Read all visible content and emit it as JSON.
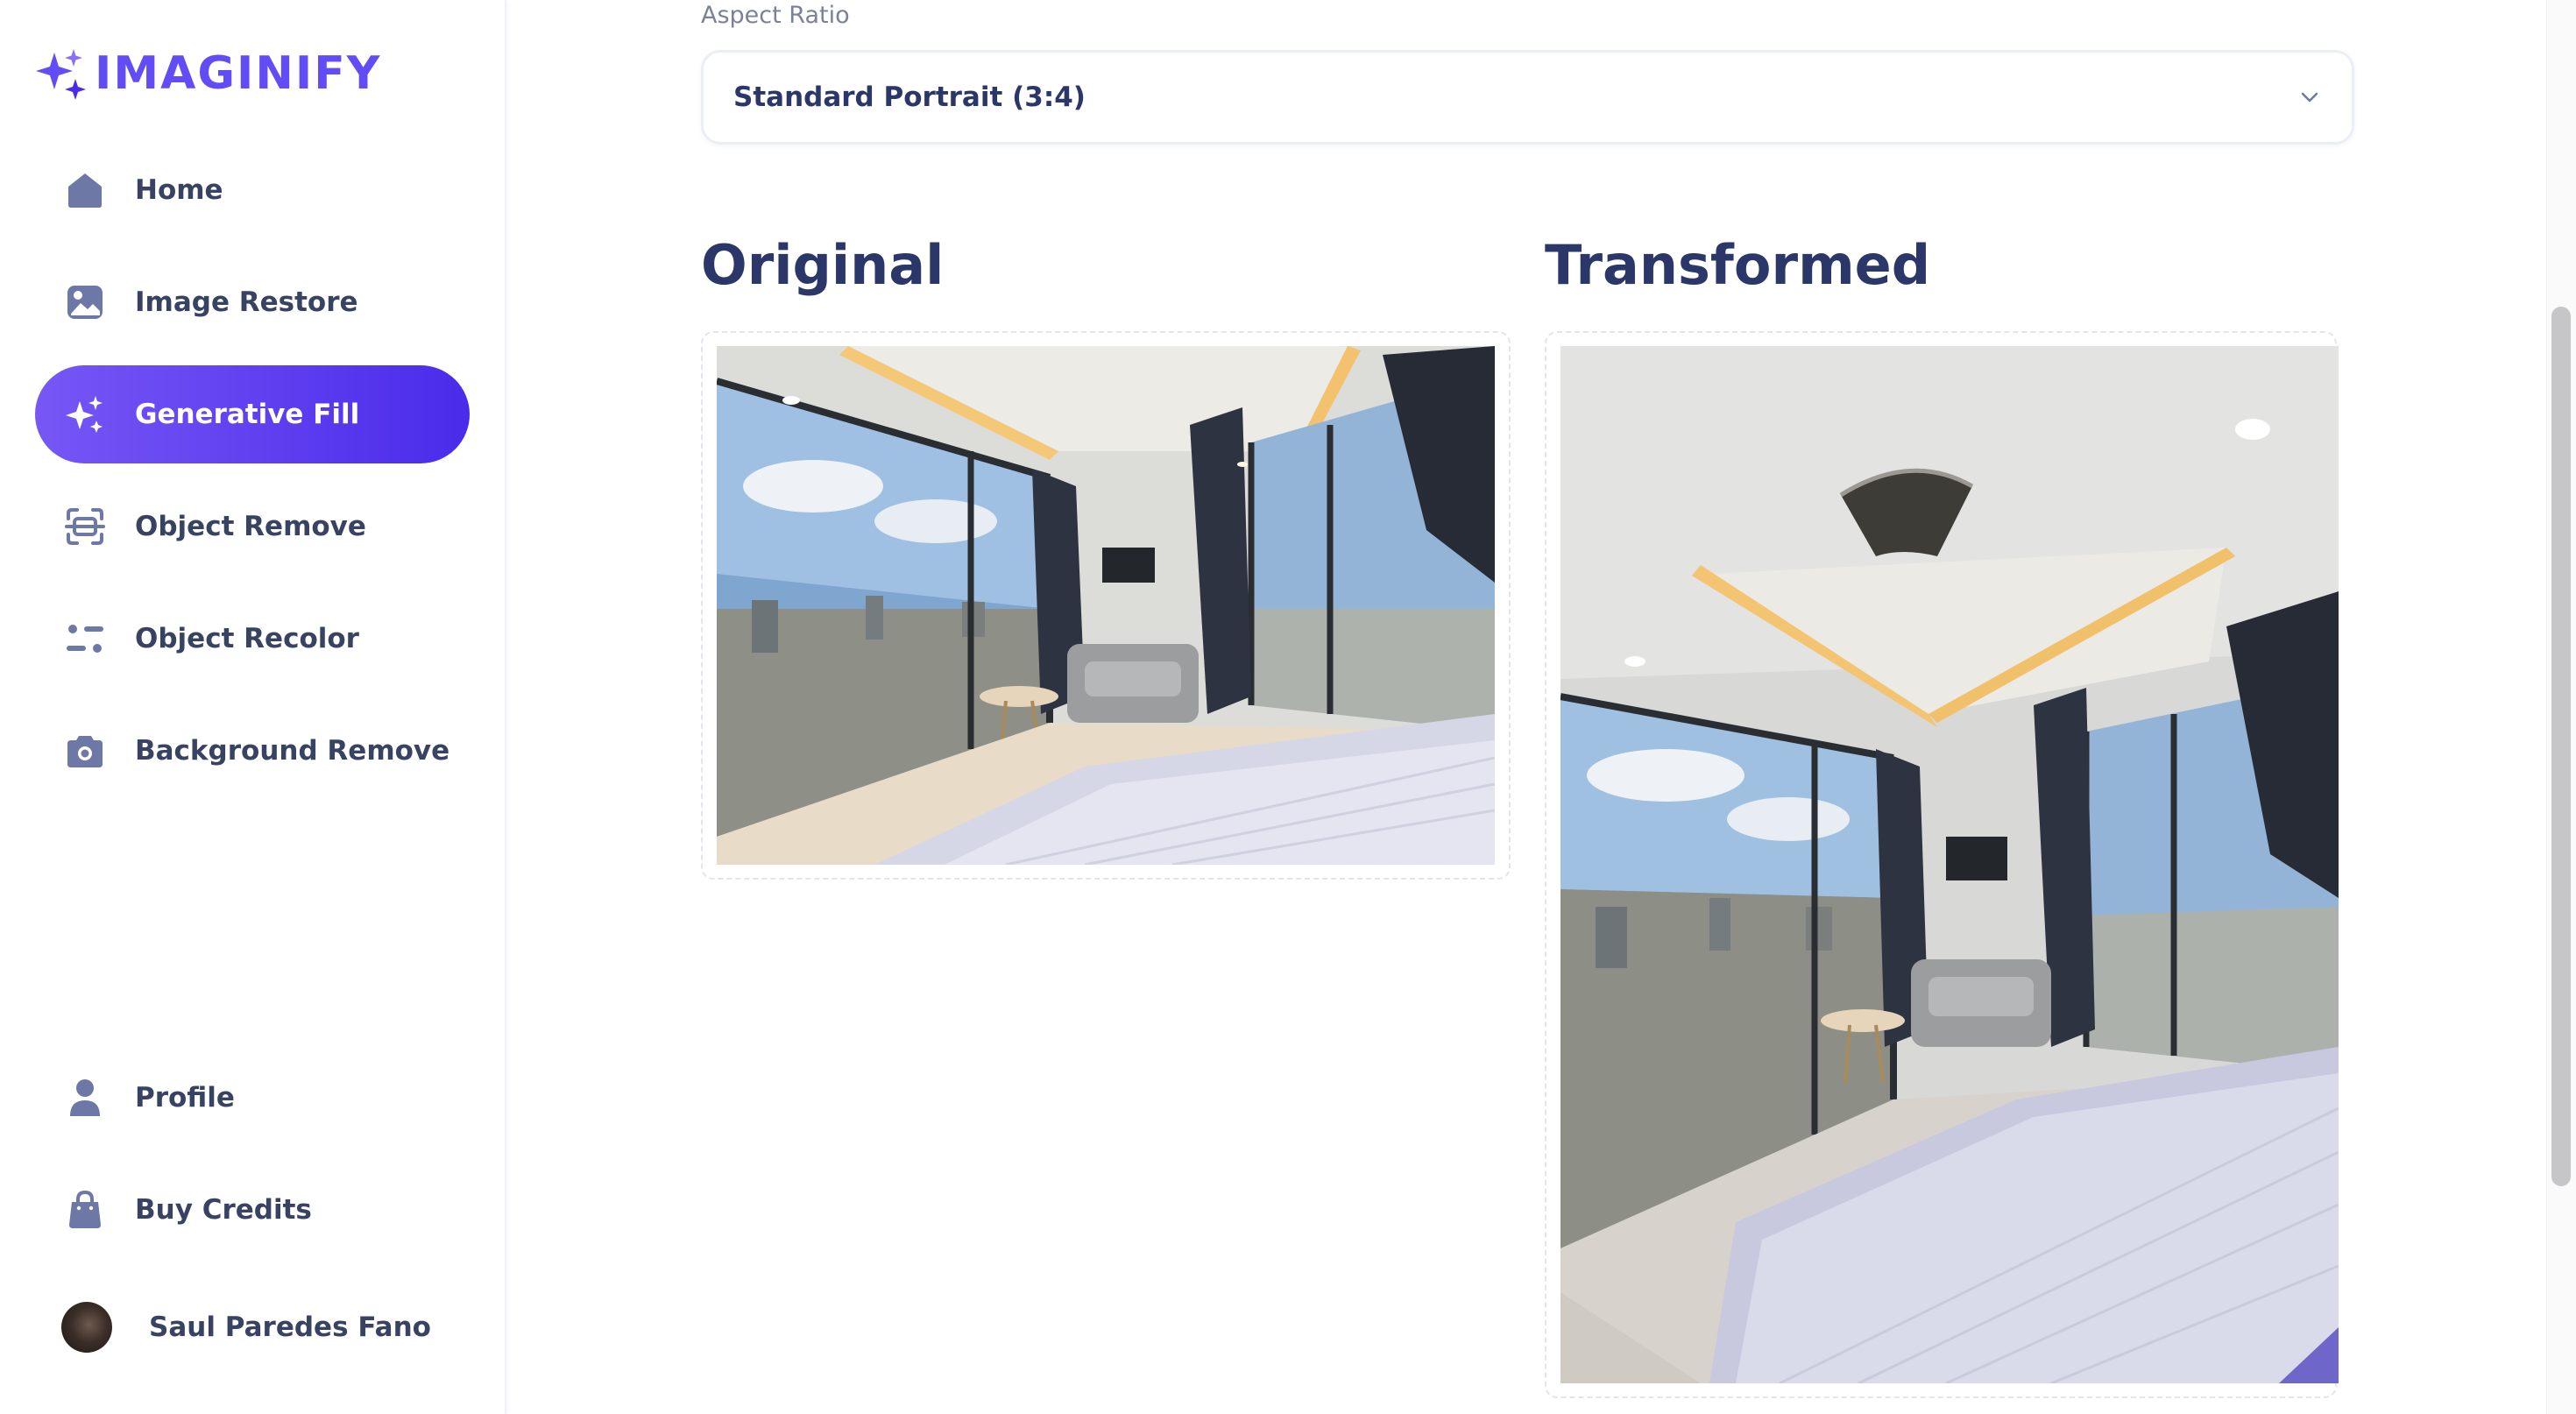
{
  "app": {
    "name": "IMAGINIFY"
  },
  "sidebar": {
    "items": [
      {
        "label": "Home",
        "icon": "home-icon"
      },
      {
        "label": "Image Restore",
        "icon": "image-icon"
      },
      {
        "label": "Generative Fill",
        "icon": "stars-icon",
        "active": true
      },
      {
        "label": "Object Remove",
        "icon": "scan-icon"
      },
      {
        "label": "Object Recolor",
        "icon": "filter-icon"
      },
      {
        "label": "Background Remove",
        "icon": "camera-icon"
      }
    ],
    "bottom_items": [
      {
        "label": "Profile",
        "icon": "user-icon"
      },
      {
        "label": "Buy Credits",
        "icon": "bag-icon"
      }
    ],
    "user": {
      "name": "Saul Paredes Fano"
    }
  },
  "form": {
    "aspect_ratio_label": "Aspect Ratio",
    "aspect_ratio_value": "Standard Portrait (3:4)"
  },
  "panels": {
    "original_title": "Original",
    "transformed_title": "Transformed"
  },
  "colors": {
    "accent": "#624cf5",
    "active_gradient_start": "#7757f5",
    "active_gradient_end": "#4a2bea",
    "heading": "#2b3768",
    "text": "#384262"
  }
}
